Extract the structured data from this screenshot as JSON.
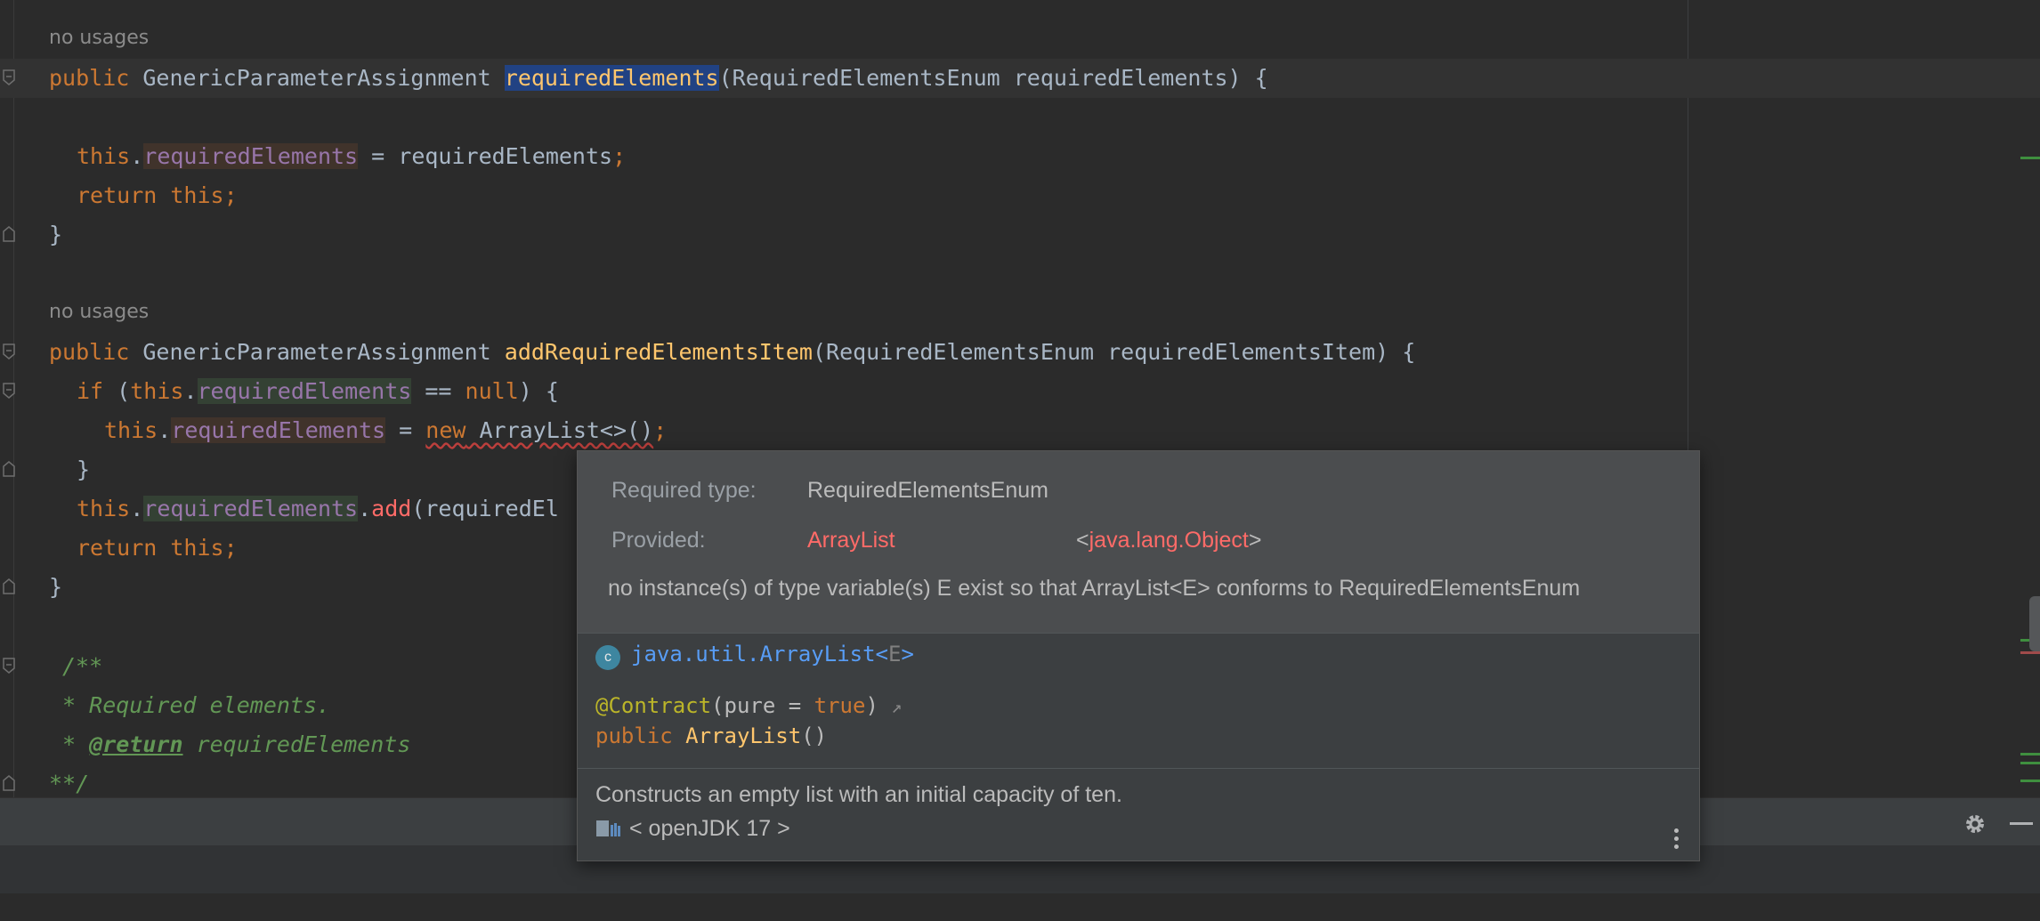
{
  "editor": {
    "hints": {
      "no_usages_1": "no usages",
      "no_usages_2": "no usages"
    },
    "line1": {
      "kw_public": "public",
      "type": "GenericParameterAssignment",
      "method": "requiredElements",
      "params": "(RequiredElementsEnum requiredElements) {"
    },
    "line2": {
      "kw_this": "this",
      "dot": ".",
      "field": "requiredElements",
      "rest": " = requiredElements",
      "semi": ";"
    },
    "line3": {
      "kw_return": "return",
      "kw_this": "this",
      "semi": ";"
    },
    "line4": {
      "brace": "}"
    },
    "line5": {
      "kw_public": "public",
      "type": "GenericParameterAssignment",
      "method": "addRequiredElementsItem",
      "params": "(RequiredElementsEnum requiredElementsItem) {"
    },
    "line6": {
      "kw_if": "if",
      "open": " (",
      "kw_this": "this",
      "dot": ".",
      "field": "requiredElements",
      "mid": " == ",
      "kw_null": "null",
      "close": ") {"
    },
    "line7": {
      "kw_this": "this",
      "dot": ".",
      "field": "requiredElements",
      "eq": " = ",
      "kw_new": "new",
      "ctor": " ArrayList<>()",
      "semi": ";"
    },
    "line8": {
      "brace": "}"
    },
    "line9": {
      "kw_this": "this",
      "dot": ".",
      "field": "requiredElements",
      "dot2": ".",
      "add": "add",
      "rest": "(requiredEl"
    },
    "line10": {
      "kw_return": "return",
      "kw_this": "this",
      "semi": ";"
    },
    "line11": {
      "brace": "}"
    },
    "comment": {
      "open": "/**",
      "line1": " * Required elements.",
      "star": " * ",
      "tag": "@return",
      "tag_rest": " requiredElements",
      "close": "**/"
    }
  },
  "popup": {
    "required_label": "Required type:",
    "required_value": "RequiredElementsEnum",
    "provided_label": "Provided:",
    "provided_value": "ArrayList",
    "provided_generic_open": "<",
    "provided_generic_type": "java.lang.Object",
    "provided_generic_close": ">",
    "message": "no instance(s) of type variable(s) E exist so that ArrayList<E> conforms to RequiredElementsEnum",
    "class_badge": "c",
    "class_link": "java.util.ArrayList",
    "class_generic_open": "<",
    "class_generic_param": "E",
    "class_generic_close": ">",
    "annotation": "@Contract",
    "annotation_args_open": "(pure = ",
    "annotation_true": "true",
    "annotation_args_close": ")",
    "annotation_arrow": "↗",
    "sig_public": "public",
    "sig_name": "ArrayList",
    "sig_parens": "()",
    "description": "Constructs an empty list with an initial capacity of ten.",
    "library": "< openJDK 17 >"
  },
  "icons": {
    "fold": "fold-marker-icon",
    "gear": "gear-icon",
    "minimize": "minimize-icon",
    "class": "class-icon",
    "library": "library-icon",
    "more": "more-vertical-icon",
    "external": "external-link-icon"
  },
  "colors": {
    "background": "#2b2b2b",
    "keyword": "#cc7832",
    "method": "#ffc66d",
    "field": "#9876aa",
    "comment": "#629755",
    "error": "#ff6b68",
    "link": "#589df6",
    "selection": "#214283"
  }
}
